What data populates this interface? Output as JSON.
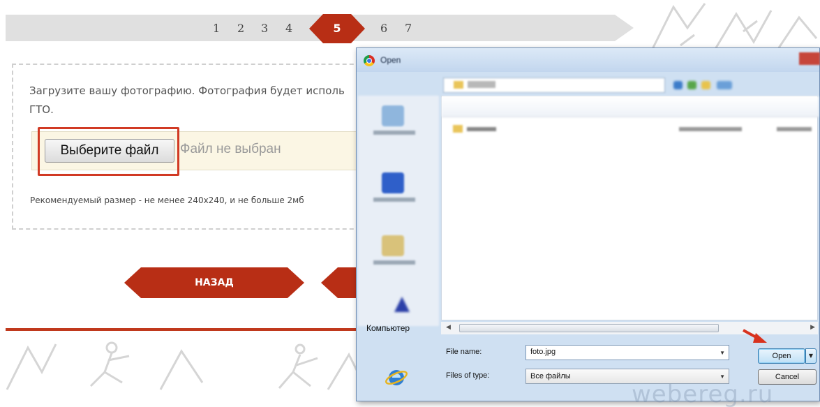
{
  "steps": {
    "items": [
      "1",
      "2",
      "3",
      "4",
      "5",
      "6",
      "7"
    ],
    "active": "5"
  },
  "upload": {
    "instruction_line1": "Загрузите вашу фотографию. Фотография будет исполь",
    "instruction_line2": "ГТО.",
    "choose_button": "Выберите файл",
    "no_file_text": "Файл не выбран",
    "recommendation": "Рекомендуемый размер - не менее 240x240, и не больше 2мб"
  },
  "navigation": {
    "back_label": "НАЗАД"
  },
  "dialog": {
    "title": "Open",
    "computer_label": "Компьютер",
    "file_name_label": "File name:",
    "file_name_value": "foto.jpg",
    "file_type_label": "Files of type:",
    "file_type_value": "Все файлы",
    "open_label": "Open",
    "cancel_label": "Cancel"
  },
  "watermark": "webereg.ru",
  "colors": {
    "accent_red": "#b82e15",
    "highlight_red": "#d13a24",
    "dialog_frame": "#cfe0f2",
    "file_field_bg": "#fbf6e4"
  },
  "icons": [
    "chrome-icon",
    "folder-icon",
    "computer-icon",
    "ie-globe-icon",
    "dropdown-arrow-icon",
    "red-arrow-icon"
  ]
}
